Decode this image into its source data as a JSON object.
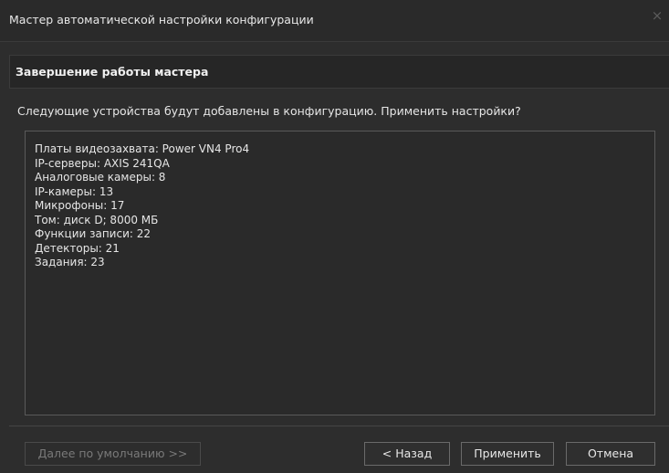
{
  "window": {
    "title": "Мастер автоматической настройки конфигурации",
    "close_glyph": "×",
    "close_icon": "close-icon"
  },
  "section": {
    "title": "Завершение работы мастера"
  },
  "prompt": "Следующие устройства будут добавлены в конфигурацию. Применить настройки?",
  "summary": [
    "Платы видеозахвата: Power VN4 Pro4",
    "IP-серверы: AXIS 241QA",
    "Аналоговые камеры: 8",
    "IP-камеры: 13",
    "Микрофоны: 17",
    "Том: диск D; 8000 МБ",
    "Функции записи: 22",
    "Детекторы: 21",
    "Задания: 23"
  ],
  "buttons": {
    "next_default": "Далее по умолчанию >>",
    "back": "< Назад",
    "apply": "Применить",
    "cancel": "Отмена"
  }
}
